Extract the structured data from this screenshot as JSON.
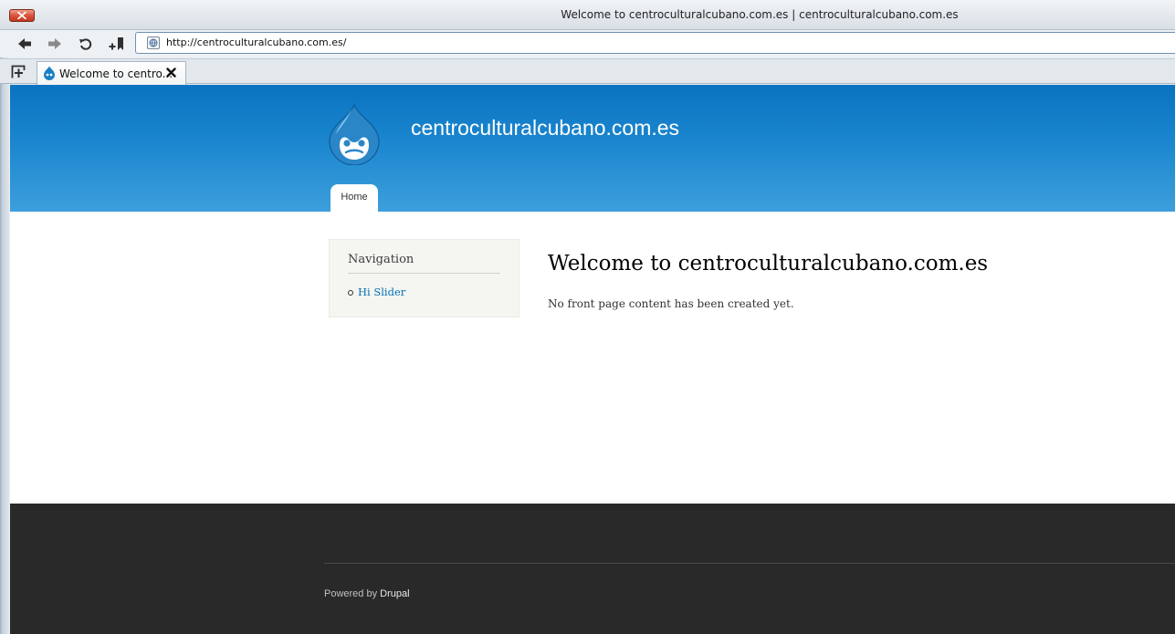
{
  "window": {
    "title": "Welcome to centroculturalcubano.com.es | centroculturalcubano.com.es"
  },
  "address_bar": {
    "url": "http://centroculturalcubano.com.es/"
  },
  "tabs": [
    {
      "label": "Welcome to centro..."
    }
  ],
  "site": {
    "name": "centroculturalcubano.com.es",
    "main_menu": [
      {
        "label": "Home"
      }
    ]
  },
  "sidebar": {
    "block_title": "Navigation",
    "links": [
      {
        "label": "Hi Slider"
      }
    ]
  },
  "content": {
    "title": "Welcome to centroculturalcubano.com.es",
    "text": "No front page content has been created yet."
  },
  "footer": {
    "powered_by": "Powered by",
    "link": "Drupal"
  },
  "colors": {
    "header_top": "#0a73c1",
    "header_bottom": "#3d9fdc",
    "link": "#0071b3",
    "footer_bg": "#292929"
  },
  "icons": {
    "window_close": "close-icon",
    "back": "arrow-left-icon",
    "forward": "arrow-right-icon",
    "reload": "reload-icon",
    "bookmark": "bookmark-add-icon",
    "site": "globe-icon",
    "new_tab": "new-tab-icon",
    "tab_favicon": "drupal-drop-icon",
    "tab_close": "close-icon"
  }
}
